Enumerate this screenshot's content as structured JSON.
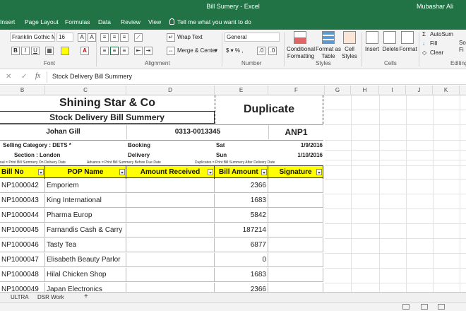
{
  "window": {
    "title": "Bill Sumery - Excel",
    "user": "Mubashar Ali"
  },
  "menu": {
    "tabs": [
      "Insert",
      "Page Layout",
      "Formulas",
      "Data",
      "Review",
      "View"
    ],
    "tell_me": "Tell me what you want to do"
  },
  "ribbon": {
    "font_name": "Franklin Gothic M",
    "font_size": "16",
    "wrap_text": "Wrap Text",
    "merge_center": "Merge & Center",
    "number_format": "General",
    "number_symbols": "$ ▾ % ,",
    "conditional_formatting": "Conditional\nFormatting",
    "format_as_table": "Format as\nTable",
    "cell_styles": "Cell\nStyles",
    "insert": "Insert",
    "delete": "Delete",
    "format": "Format",
    "autosum": "AutoSum",
    "fill": "Fill",
    "clear": "Clear",
    "sort_filter": "So\nFi",
    "groups": {
      "font": "Font",
      "alignment": "Alignment",
      "number": "Number",
      "styles": "Styles",
      "cells": "Cells",
      "editing": "Editing"
    },
    "bold": "B",
    "italic": "I",
    "underline": "U",
    "font_color": "A"
  },
  "formula_bar": {
    "content": "Stock Delivery Bill Summery",
    "fx": "fx"
  },
  "columns": [
    "B",
    "C",
    "D",
    "E",
    "F",
    "G",
    "H",
    "I",
    "J",
    "K"
  ],
  "sheet": {
    "company": "Shining Star & Co",
    "title": "Stock Delivery Bill Summery",
    "duplicate": "Duplicate",
    "customer": "Johan Gill",
    "phone": "0313-0013345",
    "code": "ANP1",
    "selling_category": "Selling Category : DETS *",
    "section": "Section : London",
    "booking": "Booking",
    "delivery": "Delivery",
    "booking_day": "Sat",
    "delivery_day": "Sun",
    "booking_date": "1/9/2016",
    "delivery_date": "1/10/2016",
    "notes": [
      "nal = Print Bill Summery On Delivery Date",
      "Advance = Print Bill Summery Before Due Date",
      "Duplicates = Print Bill Summery After Delivery Date"
    ],
    "headers": [
      "Bill No",
      "POP Name",
      "Amount Received",
      "Bill Amount",
      "Signature"
    ],
    "rows": [
      {
        "bill_no": "NP1000042",
        "pop_name": "Emporiem",
        "amount_received": "",
        "bill_amount": "2366",
        "signature": ""
      },
      {
        "bill_no": "NP1000043",
        "pop_name": "King International",
        "amount_received": "",
        "bill_amount": "1683",
        "signature": ""
      },
      {
        "bill_no": "NP1000044",
        "pop_name": "Pharma Europ",
        "amount_received": "",
        "bill_amount": "5842",
        "signature": ""
      },
      {
        "bill_no": "NP1000045",
        "pop_name": "Farnandis Cash & Carry",
        "amount_received": "",
        "bill_amount": "187214",
        "signature": ""
      },
      {
        "bill_no": "NP1000046",
        "pop_name": "Tasty Tea",
        "amount_received": "",
        "bill_amount": "6877",
        "signature": ""
      },
      {
        "bill_no": "NP1000047",
        "pop_name": "Elisabeth Beauty Parlor",
        "amount_received": "",
        "bill_amount": "0",
        "signature": ""
      },
      {
        "bill_no": "NP1000048",
        "pop_name": "Hilal Chicken Shop",
        "amount_received": "",
        "bill_amount": "1683",
        "signature": ""
      },
      {
        "bill_no": "NP1000049",
        "pop_name": "Japan Electronics",
        "amount_received": "",
        "bill_amount": "2366",
        "signature": ""
      }
    ]
  },
  "sheet_tabs": [
    "ULTRA",
    "DSR Work"
  ],
  "add_sheet": "+",
  "colors": {
    "excel_green": "#217346",
    "header_yellow": "#ffff00"
  }
}
